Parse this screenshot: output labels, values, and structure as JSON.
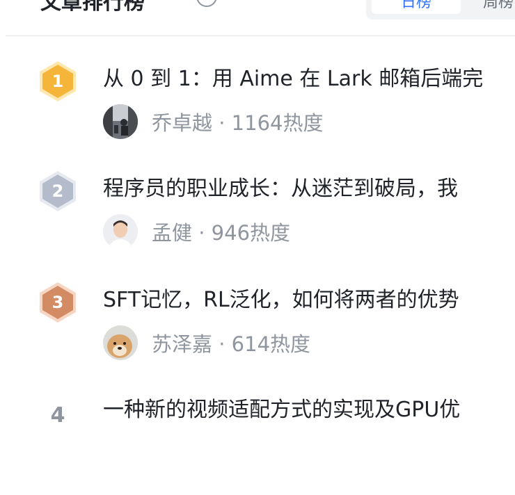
{
  "header": {
    "title": "文章排行榜",
    "tabs": [
      {
        "label": "日榜",
        "active": true
      },
      {
        "label": "周榜",
        "active": false
      }
    ]
  },
  "colors": {
    "accent": "#3370ff",
    "gold": "#f5b43a",
    "silver": "#b4bccb",
    "bronze": "#d38b63",
    "muted_text": "#8f959e"
  },
  "articles": [
    {
      "rank": "1",
      "badge": "gold",
      "title": "从 0 到 1：用 Aime 在 Lark 邮箱后端完",
      "author": "乔卓越",
      "heat": "1164热度",
      "avatar": "photo-avatar-street"
    },
    {
      "rank": "2",
      "badge": "silver",
      "title": "程序员的职业成长：从迷茫到破局，我",
      "author": "孟健",
      "heat": "946热度",
      "avatar": "photo-avatar-person"
    },
    {
      "rank": "3",
      "badge": "bronze",
      "title": "SFT记忆，RL泛化，如何将两者的优势",
      "author": "苏泽嘉",
      "heat": "614热度",
      "avatar": "photo-avatar-dog"
    },
    {
      "rank": "4",
      "badge": "none",
      "title": "一种新的视频适配方式的实现及GPU优",
      "author": "",
      "heat": "",
      "avatar": ""
    }
  ]
}
